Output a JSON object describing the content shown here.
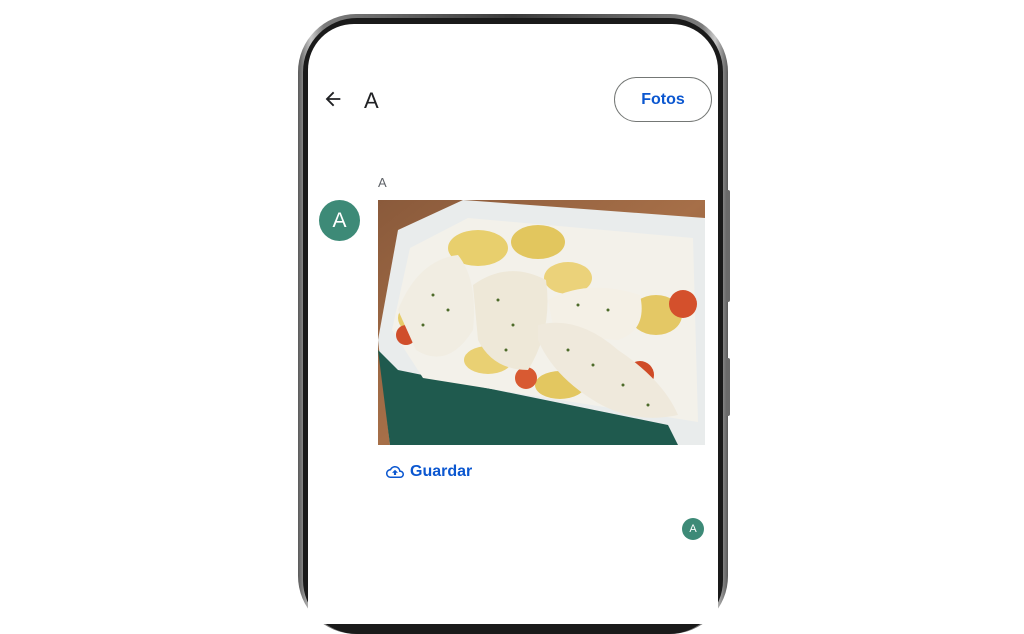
{
  "header": {
    "back_icon": "arrow-left-icon",
    "title": "A",
    "photos_button": "Fotos"
  },
  "message": {
    "sender_name": "A",
    "avatar_initial": "A",
    "avatar_color": "#3d8a77",
    "image_description_icon": "baked-fish-with-potatoes-photo",
    "save_icon": "cloud-upload-icon",
    "save_label": "Guardar"
  },
  "read_receipt": {
    "initial": "A"
  },
  "colors": {
    "accent": "#0b57d0",
    "avatar": "#3d8a77",
    "text": "#202124"
  }
}
